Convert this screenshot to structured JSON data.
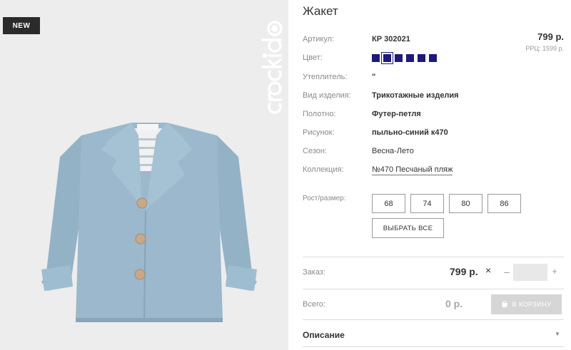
{
  "image": {
    "badge": "NEW",
    "brand": "crockid",
    "jacket_color": "#9bb8cc"
  },
  "product": {
    "title": "Жакет",
    "price": "799 р.",
    "rrp": "РРЦ: 1599 р."
  },
  "attributes": {
    "article": {
      "label": "Артикул:",
      "value": "КР 302021"
    },
    "color": {
      "label": "Цвет:"
    },
    "insulation": {
      "label": "Утеплитель:",
      "value": "\""
    },
    "type": {
      "label": "Вид изделия:",
      "value": "Трикотажные изделия"
    },
    "fabric": {
      "label": "Полотно:",
      "value": "Футер-петля"
    },
    "pattern": {
      "label": "Рисунок:",
      "value": "пыльно-синий к470"
    },
    "season": {
      "label": "Сезон:",
      "value": "Весна-Лето"
    },
    "collection": {
      "label": "Коллекция:",
      "value": "№470 Песчаный пляж"
    }
  },
  "swatches": {
    "color": "#1e1a7a",
    "count": 6,
    "selected_index": 1
  },
  "sizes": {
    "label": "Рост/размер:",
    "options": [
      "68",
      "74",
      "80",
      "86"
    ],
    "select_all": "ВЫБРАТЬ ВСЕ"
  },
  "order": {
    "label": "Заказ:",
    "price": "799 р.",
    "times": "×",
    "minus": "–",
    "plus": "+",
    "quantity": ""
  },
  "total": {
    "label": "Всего:",
    "value": "0 р.",
    "cart_button": "В КОРЗИНУ"
  },
  "description": {
    "label": "Описание",
    "chevron": "▼"
  }
}
